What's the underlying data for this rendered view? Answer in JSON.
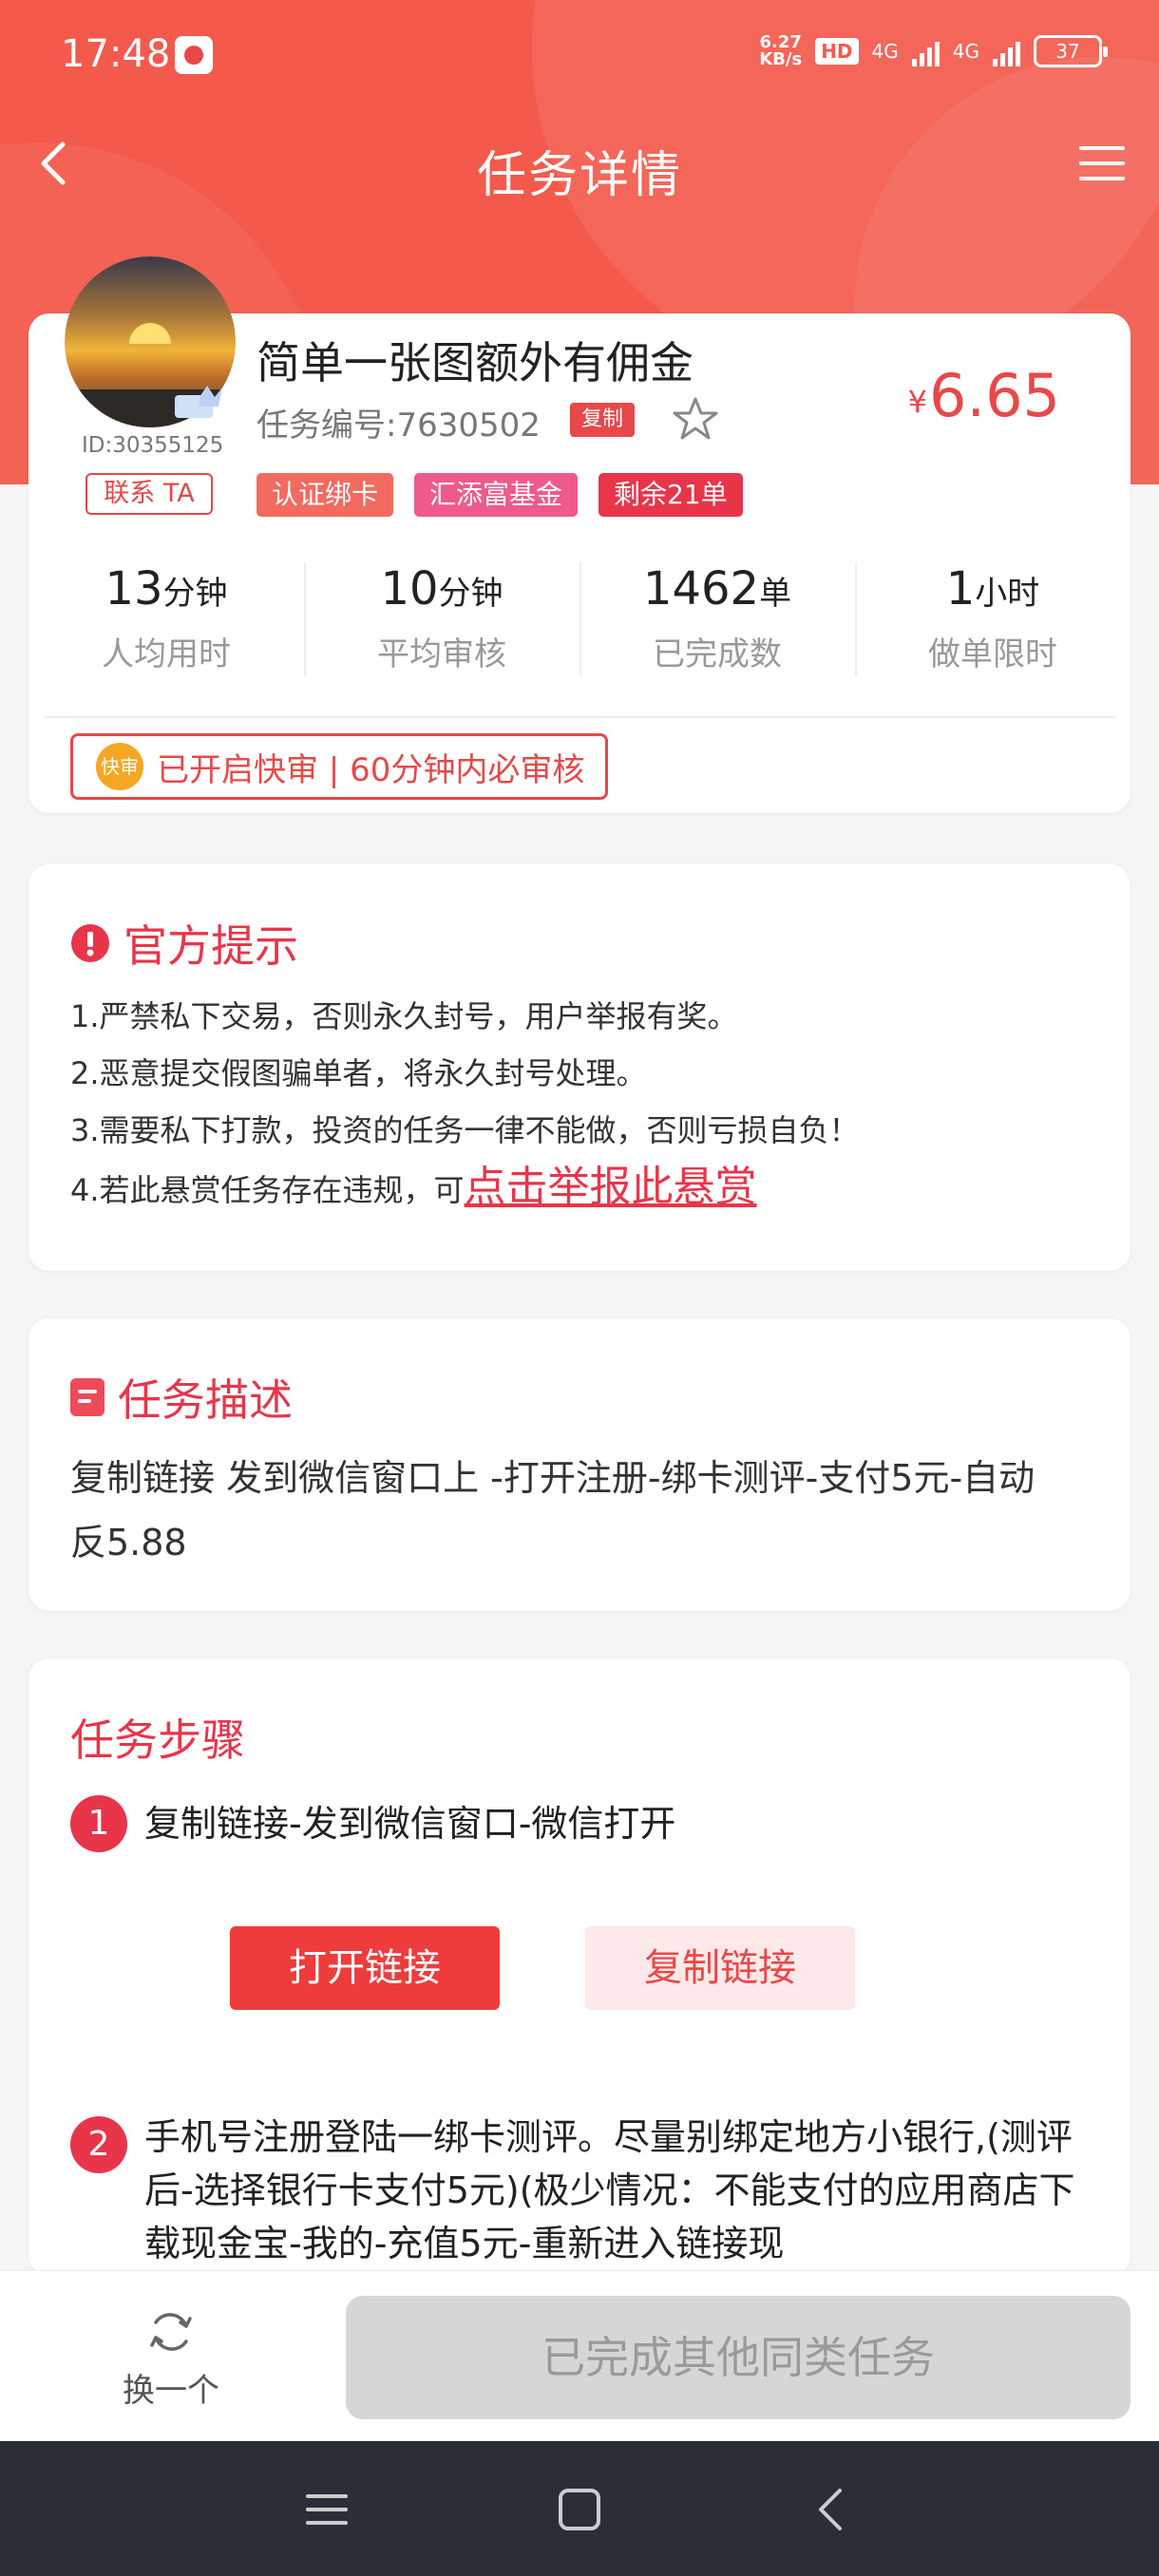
{
  "status_bar": {
    "time": "17:48",
    "net_speed_top": "6.27",
    "net_speed_bottom": "KB/s",
    "hd": "HD",
    "network1": "4G",
    "network2": "4G",
    "battery": "37"
  },
  "header": {
    "title": "任务详情"
  },
  "task": {
    "user_id": "ID:30355125",
    "contact_label": "联系 TA",
    "title": "简单一张图额外有佣金",
    "task_no": "任务编号:7630502",
    "copy_label": "复制",
    "price_symbol": "¥",
    "price": "6.65",
    "tags": [
      "认证绑卡",
      "汇添富基金",
      "剩余21单"
    ],
    "stats": [
      {
        "value": "13",
        "unit": "分钟",
        "label": "人均用时"
      },
      {
        "value": "10",
        "unit": "分钟",
        "label": "平均审核"
      },
      {
        "value": "1462",
        "unit": "单",
        "label": "已完成数"
      },
      {
        "value": "1",
        "unit": "小时",
        "label": "做单限时"
      }
    ],
    "fast_icon_text": "快审",
    "fast_review": "已开启快审 | 60分钟内必审核"
  },
  "tips": {
    "title": "官方提示",
    "items": [
      "1.严禁私下交易，否则永久封号，用户举报有奖。",
      "2.恶意提交假图骗单者，将永久封号处理。",
      "3.需要私下打款，投资的任务一律不能做，否则亏损自负！",
      "4.若此悬赏任务存在违规，可"
    ],
    "report_link": "点击举报此悬赏"
  },
  "description": {
    "title": "任务描述",
    "text": "复制链接 发到微信窗口上 -打开注册-绑卡测评-支付5元-自动反5.88"
  },
  "steps": {
    "title": "任务步骤",
    "items": [
      {
        "num": "1",
        "text": "复制链接-发到微信窗口-微信打开"
      },
      {
        "num": "2",
        "text": "手机号注册登陆一绑卡测评。尽量别绑定地方小银行,(测评后-选择银行卡支付5元)(极少情况：不能支付的应用商店下载现金宝-我的-充值5元-重新进入链接现"
      }
    ],
    "open_link_label": "打开链接",
    "copy_link_label": "复制链接"
  },
  "bottom": {
    "swap_label": "换一个",
    "done_label": "已完成其他同类任务"
  },
  "colors": {
    "header_bg": "#f35a4c",
    "accent": "#e8354a",
    "price": "#e84848",
    "disabled_btn": "#d6d6d6"
  }
}
